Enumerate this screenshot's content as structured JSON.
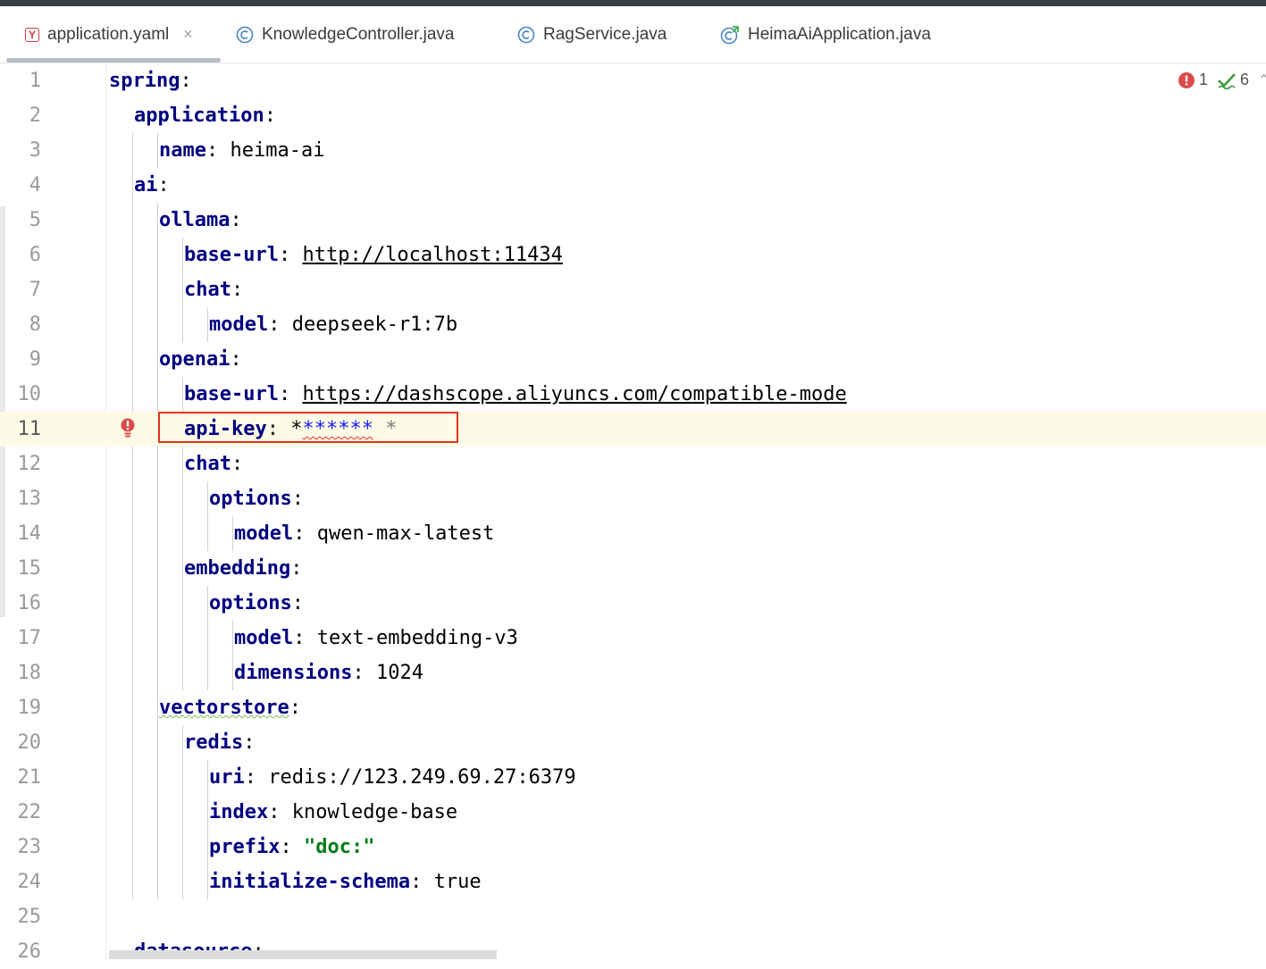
{
  "tabs": [
    {
      "label": "application.yaml",
      "icon": "yaml-file-icon",
      "active": true,
      "close": "×"
    },
    {
      "label": "KnowledgeController.java",
      "icon": "java-class-icon"
    },
    {
      "label": "RagService.java",
      "icon": "java-class-icon"
    },
    {
      "label": "HeimaAiApplication.java",
      "icon": "java-app-class-icon"
    }
  ],
  "status": {
    "errors": "1",
    "warnings": "6"
  },
  "lines": [
    {
      "n": "1",
      "key": "spring",
      "colon": ":"
    },
    {
      "n": "2",
      "key": "application",
      "colon": ":"
    },
    {
      "n": "3",
      "key": "name",
      "colon": ": ",
      "value": "heima-ai"
    },
    {
      "n": "4",
      "key": "ai",
      "colon": ":"
    },
    {
      "n": "5",
      "key": "ollama",
      "colon": ":"
    },
    {
      "n": "6",
      "key": "base-url",
      "colon": ": ",
      "value": "http://localhost:11434"
    },
    {
      "n": "7",
      "key": "chat",
      "colon": ":"
    },
    {
      "n": "8",
      "key": "model",
      "colon": ": ",
      "value": "deepseek-r1:7b"
    },
    {
      "n": "9",
      "key": "openai",
      "colon": ":"
    },
    {
      "n": "10",
      "key": "base-url",
      "colon": ": ",
      "value": "https://dashscope.aliyuncs.com/compatible-mode"
    },
    {
      "n": "11",
      "key": "api-key",
      "colon": ": ",
      "value_first": "*",
      "value_mask": "******",
      "value_tail": " *"
    },
    {
      "n": "12",
      "key": "chat",
      "colon": ":"
    },
    {
      "n": "13",
      "key": "options",
      "colon": ":"
    },
    {
      "n": "14",
      "key": "model",
      "colon": ": ",
      "value": "qwen-max-latest"
    },
    {
      "n": "15",
      "key": "embedding",
      "colon": ":"
    },
    {
      "n": "16",
      "key": "options",
      "colon": ":"
    },
    {
      "n": "17",
      "key": "model",
      "colon": ": ",
      "value": "text-embedding-v3"
    },
    {
      "n": "18",
      "key": "dimensions",
      "colon": ": ",
      "value": "1024"
    },
    {
      "n": "19",
      "key": "vectorstore",
      "colon": ":"
    },
    {
      "n": "20",
      "key": "redis",
      "colon": ":"
    },
    {
      "n": "21",
      "key": "uri",
      "colon": ": ",
      "value": "redis://123.249.69.27:6379"
    },
    {
      "n": "22",
      "key": "index",
      "colon": ": ",
      "value": "knowledge-base"
    },
    {
      "n": "23",
      "key": "prefix",
      "colon": ": ",
      "value": "\"doc:\""
    },
    {
      "n": "24",
      "key": "initialize-schema",
      "colon": ": ",
      "value": "true"
    },
    {
      "n": "25"
    },
    {
      "n": "26",
      "key": "datasource",
      "colon": ":"
    }
  ]
}
